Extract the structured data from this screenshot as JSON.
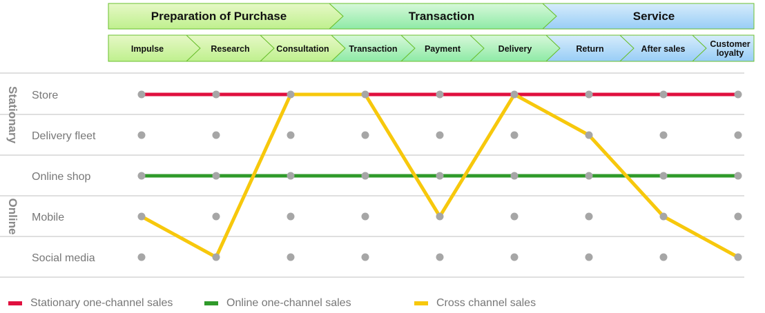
{
  "phases": [
    {
      "label": "Preparation of Purchase",
      "color_top": "#e6f8c6",
      "color_bottom": "#bff08e"
    },
    {
      "label": "Transaction",
      "color_top": "#d7f8d9",
      "color_bottom": "#8eeaa6"
    },
    {
      "label": "Service",
      "color_top": "#d6ecfb",
      "color_bottom": "#98cdf6"
    }
  ],
  "steps": [
    {
      "label": "Impulse",
      "phase": 0
    },
    {
      "label": "Research",
      "phase": 0
    },
    {
      "label": "Consultation",
      "phase": 0
    },
    {
      "label": "Transaction",
      "phase": 1
    },
    {
      "label": "Payment",
      "phase": 1
    },
    {
      "label": "Delivery",
      "phase": 1
    },
    {
      "label": "Return",
      "phase": 2
    },
    {
      "label": "After sales",
      "phase": 2
    },
    {
      "label": "Customer loyalty",
      "phase": 2
    }
  ],
  "groups": [
    {
      "label": "Stationary",
      "rows": [
        0,
        1
      ]
    },
    {
      "label": "Online",
      "rows": [
        2,
        3,
        4
      ]
    }
  ],
  "channels": [
    "Store",
    "Delivery fleet",
    "Online shop",
    "Mobile",
    "Social media"
  ],
  "paths": [
    {
      "name": "Stationary one-channel sales",
      "color": "#e0103f",
      "channel_per_step": [
        0,
        0,
        0,
        0,
        0,
        0,
        0,
        0,
        0
      ]
    },
    {
      "name": "Online one-channel sales",
      "color": "#2f9a2a",
      "channel_per_step": [
        2,
        2,
        2,
        2,
        2,
        2,
        2,
        2,
        2
      ]
    },
    {
      "name": "Cross channel sales",
      "color": "#f7c80c",
      "channel_per_step": [
        3,
        4,
        0,
        0,
        3,
        0,
        1,
        3,
        4
      ]
    }
  ],
  "colors": {
    "node": "#a6a6a6",
    "divider": "#cccccc",
    "text": "#777777",
    "group_text": "#888888",
    "arrow_border": "#6abf2e"
  }
}
